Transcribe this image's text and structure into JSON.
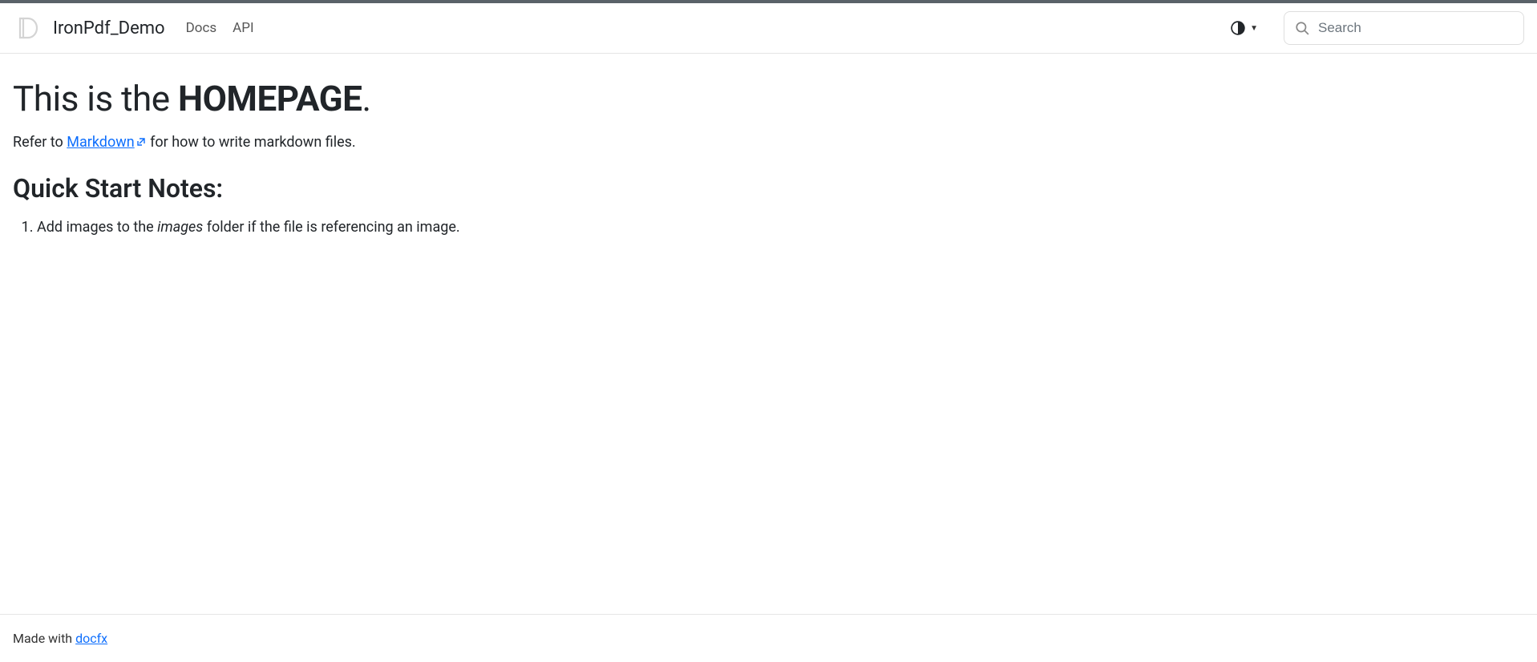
{
  "header": {
    "brand": "IronPdf_Demo",
    "nav": {
      "docs": "Docs",
      "api": "API"
    },
    "search": {
      "placeholder": "Search"
    }
  },
  "main": {
    "title_prefix": "This is the ",
    "title_bold": "HOMEPAGE",
    "title_suffix": ".",
    "intro_prefix": "Refer to ",
    "intro_link": "Markdown",
    "intro_suffix": " for how to write markdown files.",
    "section_heading": "Quick Start Notes:",
    "note_prefix": "Add images to the ",
    "note_italic": "images",
    "note_suffix": " folder if the file is referencing an image."
  },
  "footer": {
    "prefix": "Made with ",
    "link": "docfx"
  }
}
